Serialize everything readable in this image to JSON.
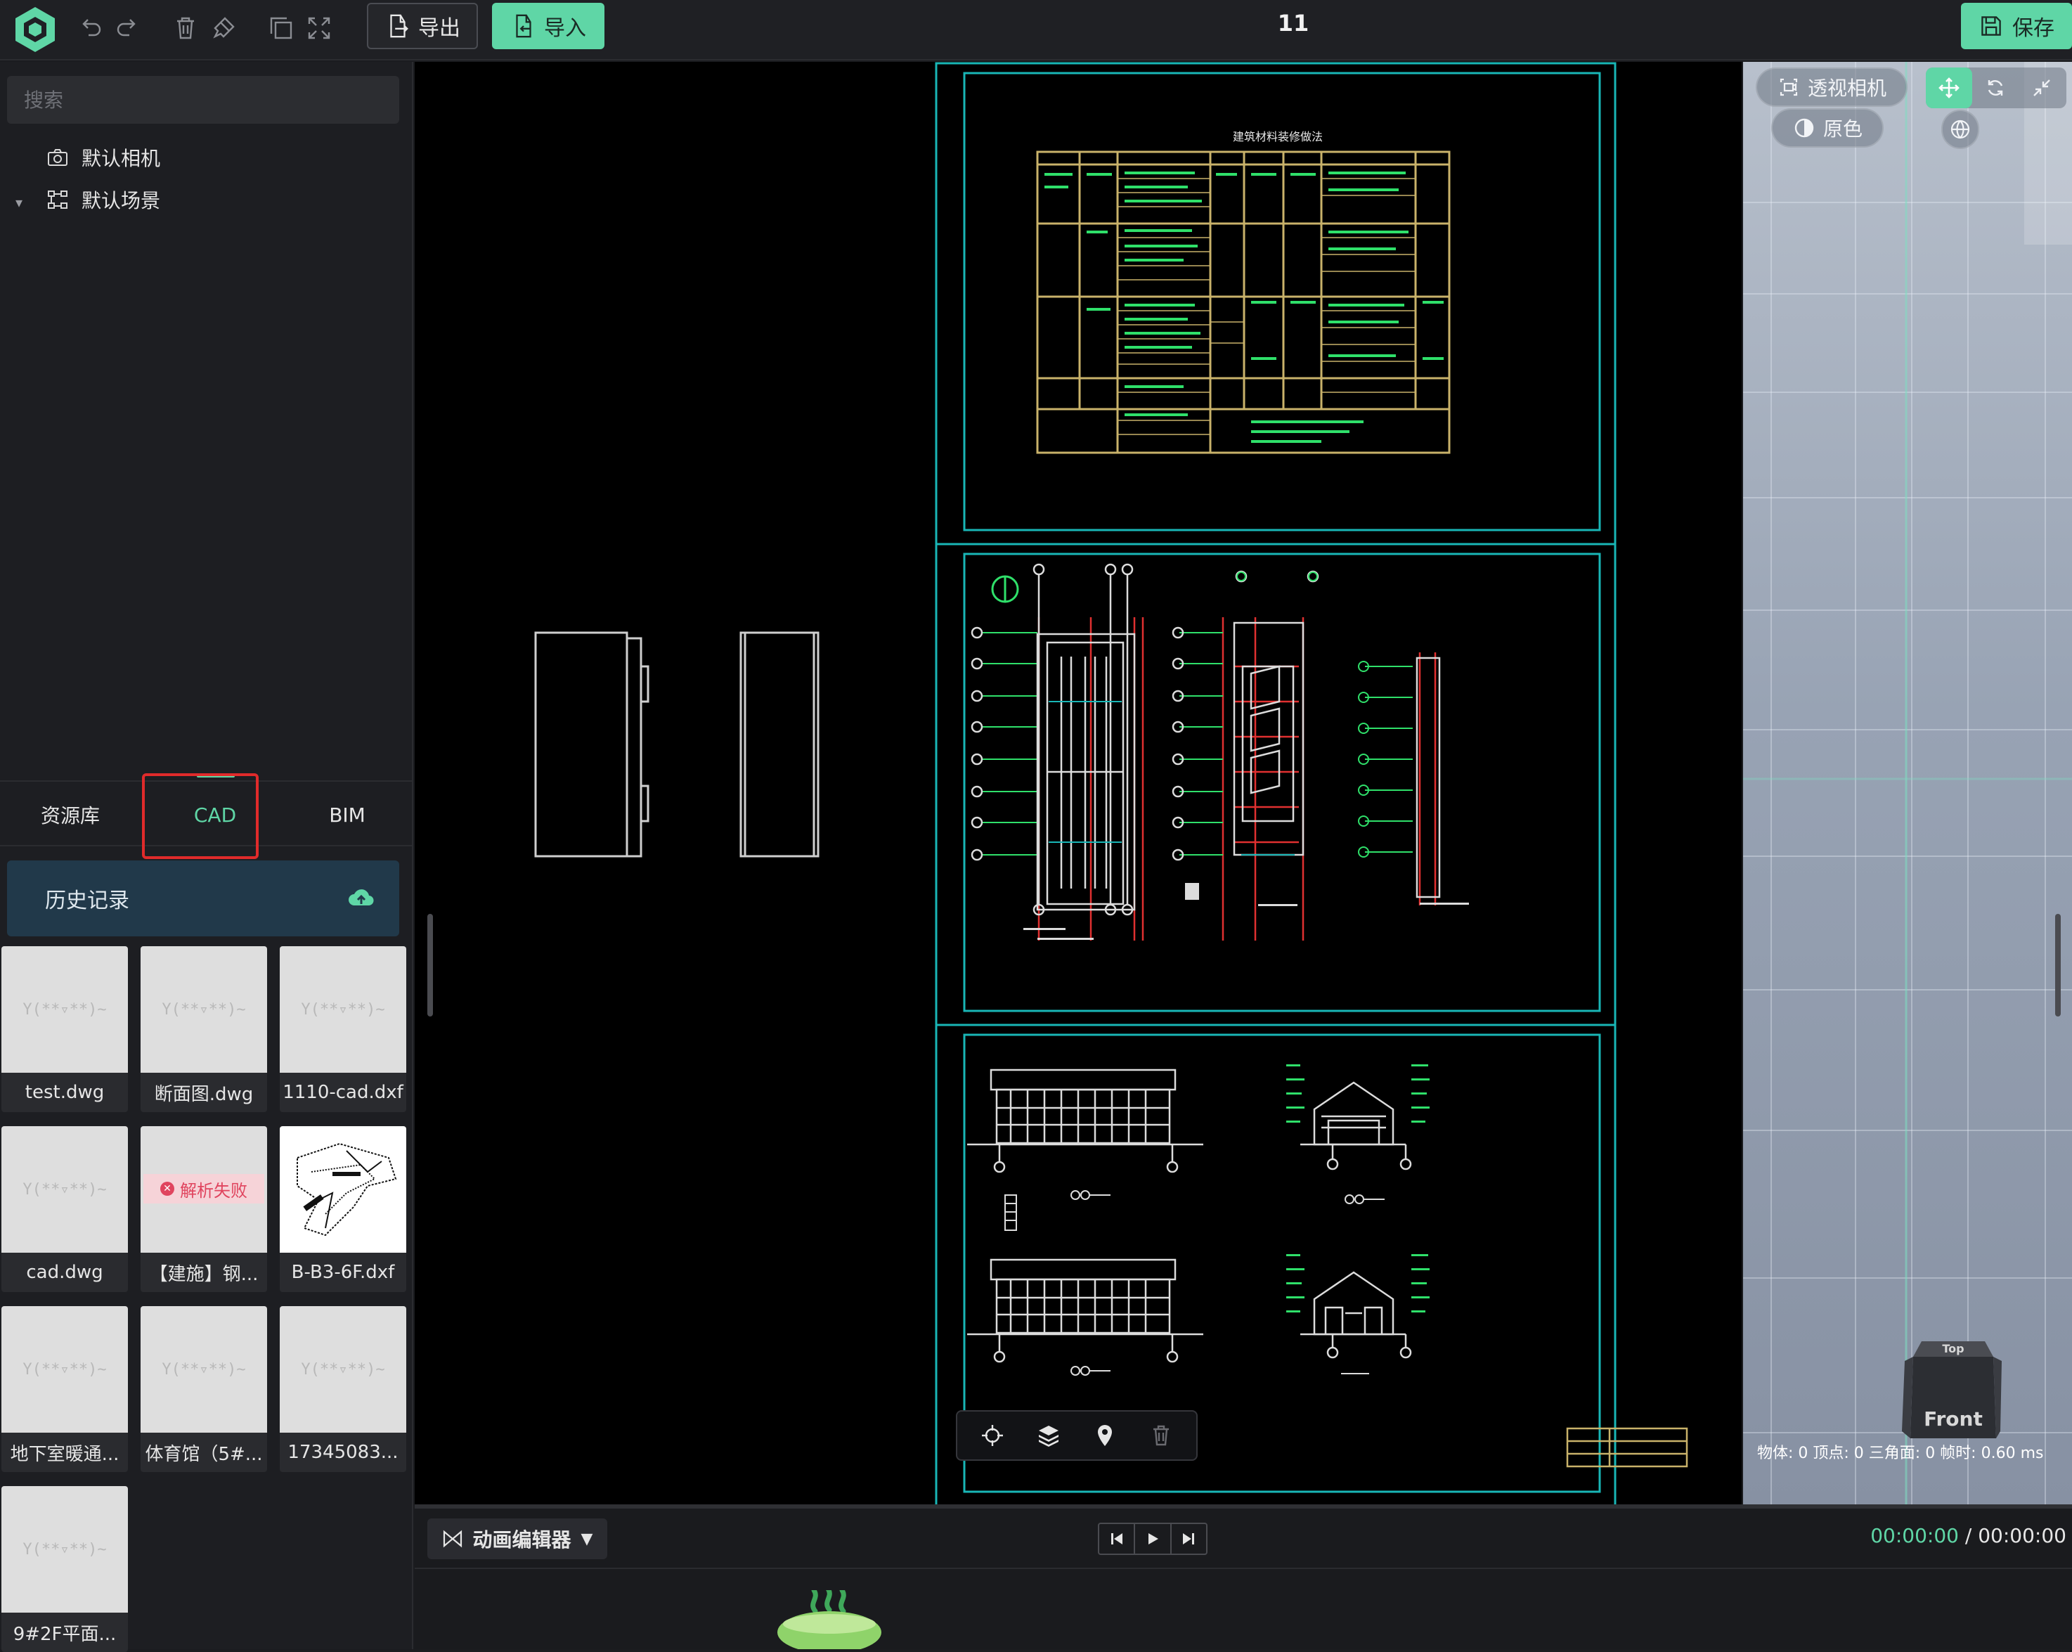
{
  "topbar": {
    "title": "11",
    "export_label": "导出",
    "import_label": "导入",
    "save_label": "保存",
    "accent_color": "#5fd6a6"
  },
  "scene_tree": {
    "search_placeholder": "搜索",
    "items": [
      {
        "label": "默认相机",
        "icon": "camera-icon"
      },
      {
        "label": "默认场景",
        "icon": "scene-icon"
      }
    ]
  },
  "panel_tabs": [
    {
      "label": "资源库",
      "active": false
    },
    {
      "label": "CAD",
      "active": true
    },
    {
      "label": "BIM",
      "active": false
    }
  ],
  "history": {
    "label": "历史记录",
    "icon": "cloud-upload-icon"
  },
  "files": [
    {
      "name": "test.dwg",
      "status": ""
    },
    {
      "name": "断面图.dwg",
      "status": ""
    },
    {
      "name": "1110-cad.dxf",
      "status": ""
    },
    {
      "name": "cad.dwg",
      "status": ""
    },
    {
      "name": "【建施】钢...",
      "status": "解析失败"
    },
    {
      "name": "B-B3-6F.dxf",
      "status": ""
    },
    {
      "name": "地下室暖通...",
      "status": ""
    },
    {
      "name": "体育馆（5#...",
      "status": ""
    },
    {
      "name": "17345083...",
      "status": ""
    },
    {
      "name": "9#2F平面...",
      "status": ""
    }
  ],
  "placeholder_glyph": "Y(**▿**)~",
  "cad": {
    "sheet1_title": "建筑材料装修做法",
    "annotation_green": "#2fe06a",
    "frame_color": "#19b6b6",
    "table_color": "#c9b26a"
  },
  "viewport": {
    "camera_label": "透视相机",
    "color_label": "原色",
    "cube_top": "Top",
    "cube_front": "Front",
    "stats": "物体: 0  顶点: 0  三角面: 0  帧时: 0.60 ms"
  },
  "timeline": {
    "editor_label": "动画编辑器",
    "current_time": "00:00:00",
    "separator": " / ",
    "total_time": "00:00:00"
  }
}
